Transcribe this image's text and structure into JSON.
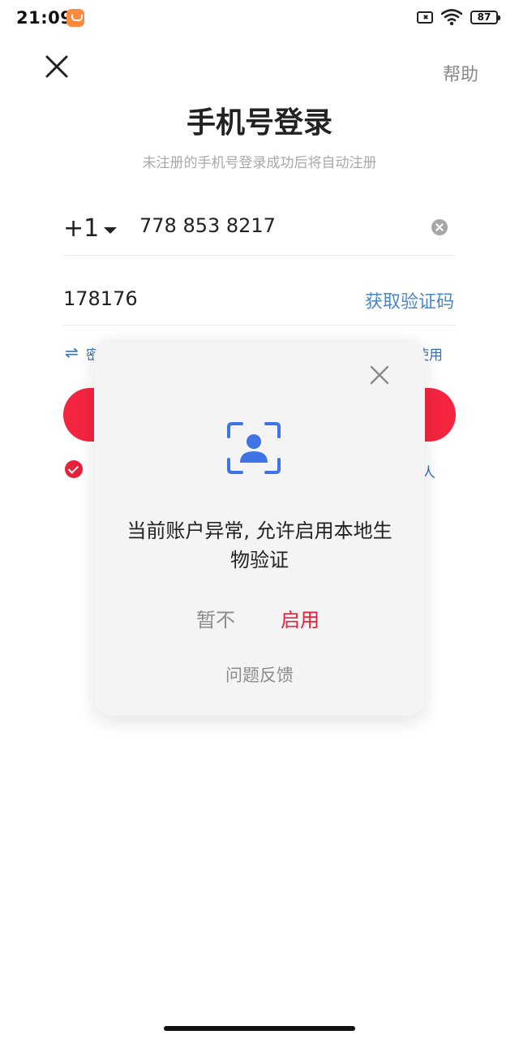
{
  "status_bar": {
    "time": "21:09",
    "battery": "87",
    "icons": [
      "app-notification-icon",
      "sim-off-icon",
      "wifi-icon",
      "battery-icon"
    ]
  },
  "header": {
    "close_icon": "close-icon",
    "help_label": "帮助",
    "title": "手机号登录",
    "subtitle": "未注册的手机号登录成功后将自动注册"
  },
  "form": {
    "country_code": "+1",
    "phone_value": "778 853 8217",
    "code_value": "178176",
    "get_code_label": "获取验证码",
    "switch_text_partial": "密",
    "other_text_partial": "使用",
    "agree_tail_partial": "人"
  },
  "modal": {
    "message": "当前账户异常, 允许启用本地生物验证",
    "deny_label": "暂不",
    "enable_label": "启用",
    "feedback_label": "问题反馈",
    "icon": "face-recognition-icon"
  },
  "colors": {
    "accent_red": "#e8213b",
    "button_red": "#f5243f",
    "link_blue": "#4a86c8",
    "icon_blue": "#3e74e6",
    "modal_bg": "#f4f4f4"
  }
}
